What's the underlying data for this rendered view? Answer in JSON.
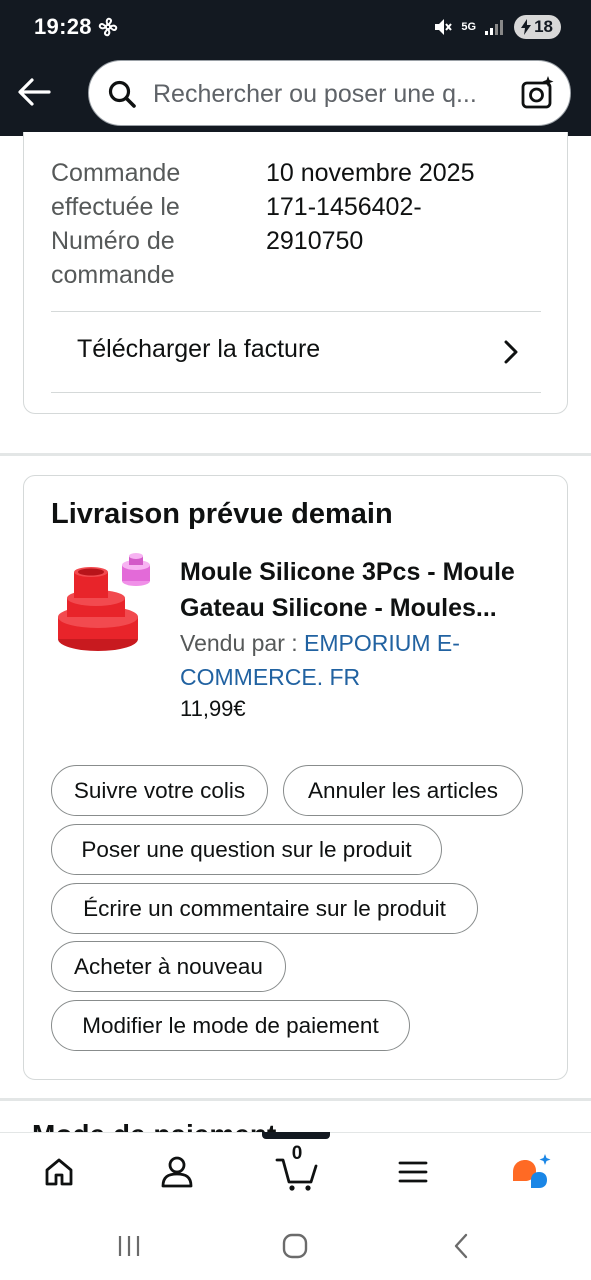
{
  "status_bar": {
    "time": "19:28",
    "network": "5G",
    "battery": "18"
  },
  "search": {
    "placeholder": "Rechercher ou poser une q..."
  },
  "order_info": {
    "date_label": "Commande effectuée le",
    "date_value": "10 novembre 2025",
    "number_label": "Numéro de commande",
    "number_value": "171-1456402-2910750",
    "invoice_label": "Télécharger la facture"
  },
  "delivery": {
    "title": "Livraison prévue demain",
    "product_title": "Moule Silicone 3Pcs - Moule Gateau Silicone - Moules...",
    "sold_by_label": "Vendu par  : ",
    "seller": "EMPORIUM E-COMMERCE. FR",
    "price": "11,99€",
    "actions": {
      "track": "Suivre votre colis",
      "cancel": "Annuler les articles",
      "question": "Poser une question sur le produit",
      "review": "Écrire un commentaire sur le produit",
      "buy_again": "Acheter à nouveau",
      "payment": "Modifier le mode de paiement"
    }
  },
  "next_section": {
    "heading": "Mode de paiement"
  },
  "bottom_nav": {
    "cart_count": "0"
  },
  "colors": {
    "header_bg": "#131921",
    "link": "#2162a1",
    "product_red": "#e8242a",
    "product_pink": "#e36ad8",
    "rufus_orange": "#ff6a24",
    "rufus_blue": "#1a86e6"
  }
}
